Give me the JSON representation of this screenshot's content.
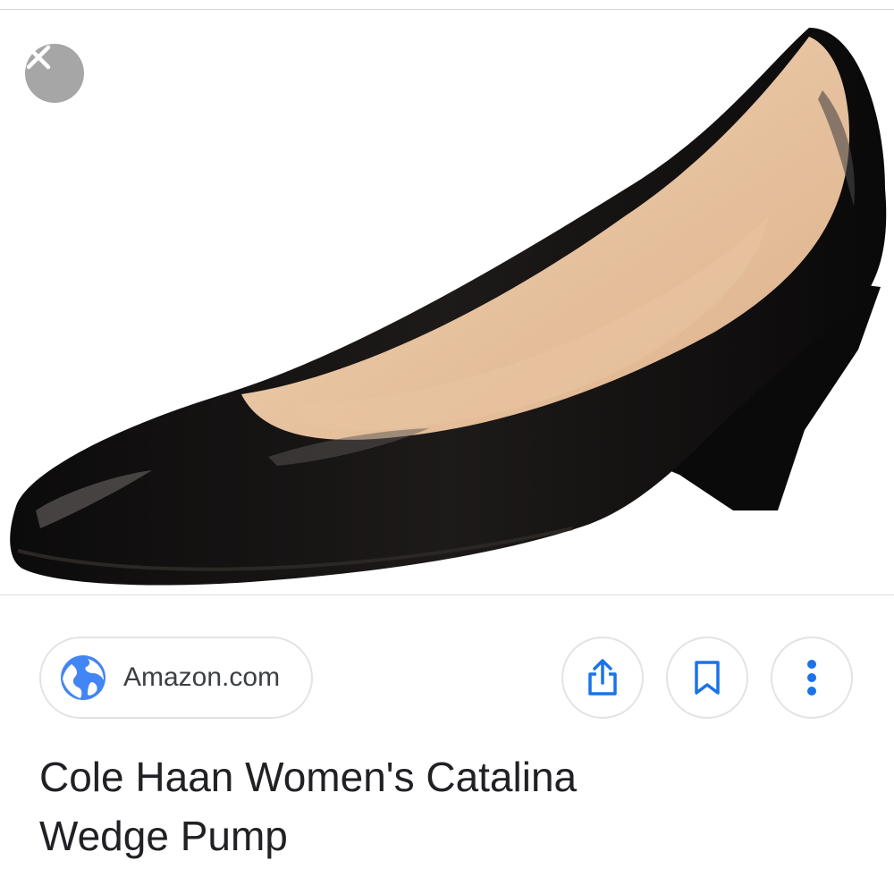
{
  "viewer": {
    "image_icon": "product-image",
    "close_icon": "close-icon"
  },
  "source": {
    "site": "Amazon.com",
    "icon": "globe-icon",
    "accent": "#4285f4"
  },
  "actions": [
    {
      "name": "share",
      "icon": "share-icon"
    },
    {
      "name": "save",
      "icon": "bookmark-icon"
    },
    {
      "name": "more",
      "icon": "more-vertical-icon"
    }
  ],
  "title": {
    "line1": "Cole Haan Women's Catalina",
    "line2": "Wedge Pump"
  }
}
